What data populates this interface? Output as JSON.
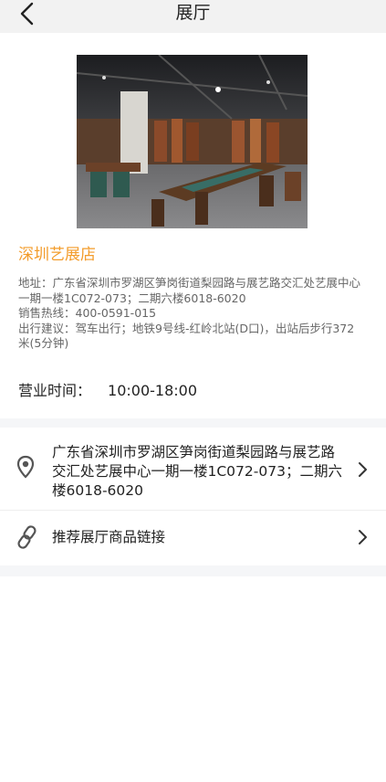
{
  "header": {
    "title": "展厅"
  },
  "store": {
    "name": "深圳艺展店",
    "address_line": "地址：广东省深圳市罗湖区笋岗街道梨园路与展艺路交汇处艺展中心一期一楼1C072-073；二期六楼6018-6020",
    "hotline": "销售热线：400-0591-015",
    "travel": "出行建议：驾车出行；地铁9号线-红岭北站(D口)，出站后步行372米(5分钟)"
  },
  "hours": {
    "label": "营业时间：",
    "value": "10:00-18:00"
  },
  "address_row": {
    "text": "广东省深圳市罗湖区笋岗街道梨园路与展艺路交汇处艺展中心一期一楼1C072-073；二期六楼6018-6020",
    "icon": "location-pin-icon"
  },
  "link_row": {
    "label": "推荐展厅商品链接",
    "icon": "link-icon"
  },
  "colors": {
    "accent": "#f39c2b",
    "divider": "#f5f6f8"
  }
}
